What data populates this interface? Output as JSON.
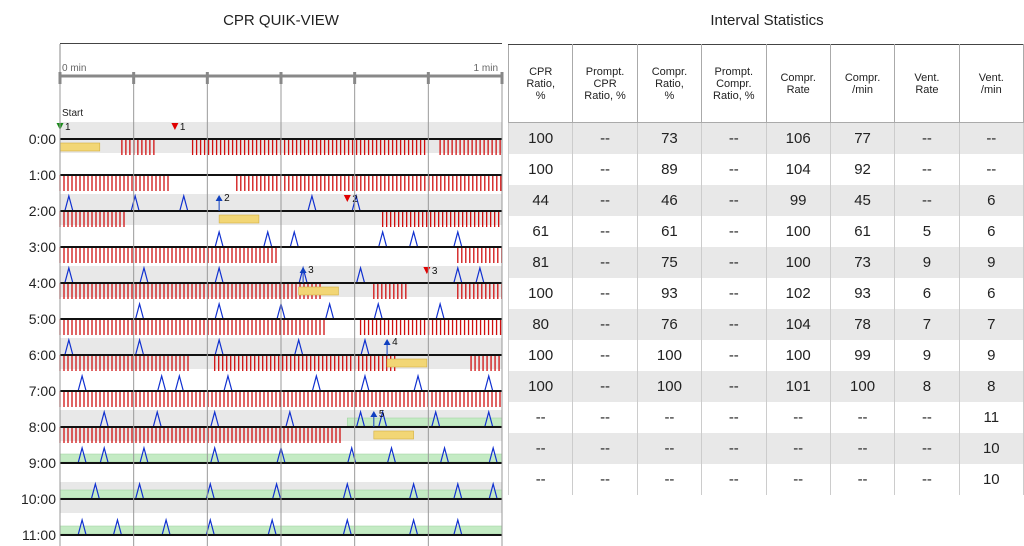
{
  "quikview": {
    "title": "CPR QUIK-VIEW",
    "axis_start": "0 min",
    "axis_end": "1 min",
    "start_label": "Start"
  },
  "stats": {
    "title": "Interval Statistics",
    "columns": [
      [
        "CPR",
        "Ratio,",
        "%"
      ],
      [
        "Prompt.",
        "CPR",
        "Ratio, %"
      ],
      [
        "Compr.",
        "Ratio,",
        "%"
      ],
      [
        "Prompt.",
        "Compr.",
        "Ratio, %"
      ],
      [
        "Compr.",
        "Rate"
      ],
      [
        "Compr.",
        "/min"
      ],
      [
        "Vent.",
        "Rate"
      ],
      [
        "Vent.",
        "/min"
      ]
    ],
    "rows": [
      [
        "100",
        "--",
        "73",
        "--",
        "106",
        "77",
        "--",
        "--"
      ],
      [
        "100",
        "--",
        "89",
        "--",
        "104",
        "92",
        "--",
        "--"
      ],
      [
        "44",
        "--",
        "46",
        "--",
        "99",
        "45",
        "--",
        "6"
      ],
      [
        "61",
        "--",
        "61",
        "--",
        "100",
        "61",
        "5",
        "6"
      ],
      [
        "81",
        "--",
        "75",
        "--",
        "100",
        "73",
        "9",
        "9"
      ],
      [
        "100",
        "--",
        "93",
        "--",
        "102",
        "93",
        "6",
        "6"
      ],
      [
        "80",
        "--",
        "76",
        "--",
        "104",
        "78",
        "7",
        "7"
      ],
      [
        "100",
        "--",
        "100",
        "--",
        "100",
        "99",
        "9",
        "9"
      ],
      [
        "100",
        "--",
        "100",
        "--",
        "101",
        "100",
        "8",
        "8"
      ],
      [
        "--",
        "--",
        "--",
        "--",
        "--",
        "--",
        "--",
        "11"
      ],
      [
        "--",
        "--",
        "--",
        "--",
        "--",
        "--",
        "--",
        "10"
      ],
      [
        "--",
        "--",
        "--",
        "--",
        "--",
        "--",
        "--",
        "10"
      ]
    ]
  },
  "timeline": {
    "minutes": [
      "0:00",
      "1:00",
      "2:00",
      "3:00",
      "4:00",
      "5:00",
      "6:00",
      "7:00",
      "8:00",
      "9:00",
      "10:00",
      "11:00"
    ],
    "compression_segments": [
      [
        [
          0.14,
          0.22
        ],
        [
          0.3,
          0.83
        ],
        [
          0.86,
          1.0
        ]
      ],
      [
        [
          0.0,
          0.25
        ],
        [
          0.4,
          1.0
        ]
      ],
      [
        [
          0.0,
          0.15
        ],
        [
          0.73,
          1.0
        ]
      ],
      [
        [
          0.0,
          0.49
        ],
        [
          0.9,
          1.0
        ]
      ],
      [
        [
          0.0,
          0.59
        ],
        [
          0.71,
          0.79
        ],
        [
          0.9,
          1.0
        ]
      ],
      [
        [
          0.0,
          0.6
        ],
        [
          0.68,
          1.0
        ]
      ],
      [
        [
          0.0,
          0.29
        ],
        [
          0.35,
          0.76
        ],
        [
          0.93,
          1.0
        ]
      ],
      [
        [
          0.0,
          1.0
        ]
      ],
      [
        [
          0.0,
          0.64
        ]
      ],
      [],
      [],
      []
    ],
    "ventilations": [
      [],
      [],
      [
        0.02,
        0.17,
        0.28,
        0.57,
        0.67
      ],
      [
        0.36,
        0.47,
        0.53,
        0.73,
        0.8,
        0.9
      ],
      [
        0.02,
        0.19,
        0.36,
        0.55,
        0.68,
        0.9,
        0.95
      ],
      [
        0.18,
        0.36,
        0.5,
        0.61,
        0.72,
        0.86
      ],
      [
        0.02,
        0.18,
        0.36,
        0.54,
        0.69
      ],
      [
        0.05,
        0.23,
        0.27,
        0.38,
        0.58,
        0.69,
        0.81,
        0.97
      ],
      [
        0.1,
        0.22,
        0.35,
        0.52,
        0.68,
        0.73,
        0.85,
        0.97
      ],
      [
        0.05,
        0.1,
        0.19,
        0.35,
        0.5,
        0.66,
        0.75,
        0.87,
        0.98
      ],
      [
        0.08,
        0.18,
        0.34,
        0.49,
        0.65,
        0.8,
        0.9,
        0.98
      ],
      [
        0.05,
        0.13,
        0.24,
        0.34,
        0.48,
        0.65,
        0.8,
        0.9
      ]
    ],
    "pauses": [
      [
        [
          0.0,
          0.09
        ]
      ],
      [],
      [
        [
          0.36,
          0.45
        ]
      ],
      [],
      [
        [
          0.54,
          0.63
        ]
      ],
      [],
      [
        [
          0.74,
          0.83
        ]
      ],
      [],
      [
        [
          0.71,
          0.8
        ]
      ],
      [],
      [],
      []
    ],
    "green_bars": [
      [],
      [],
      [],
      [],
      [],
      [],
      [],
      [],
      [
        [
          0.65,
          1.0
        ]
      ],
      [
        [
          0.0,
          1.0
        ]
      ],
      [
        [
          0.0,
          1.0
        ]
      ],
      [
        [
          0.0,
          1.0
        ]
      ]
    ],
    "markers": [
      {
        "row": 0,
        "pos": 0.0,
        "color": "#1a8a1a",
        "label": "1",
        "kind": "start"
      },
      {
        "row": 0,
        "pos": 0.26,
        "color": "#e00000",
        "label": "1",
        "kind": "down"
      },
      {
        "row": 2,
        "pos": 0.36,
        "color": "#1040c0",
        "label": "2",
        "kind": "up"
      },
      {
        "row": 2,
        "pos": 0.65,
        "color": "#e00000",
        "label": "2",
        "kind": "down"
      },
      {
        "row": 4,
        "pos": 0.55,
        "color": "#1040c0",
        "label": "3",
        "kind": "up"
      },
      {
        "row": 4,
        "pos": 0.83,
        "color": "#e00000",
        "label": "3",
        "kind": "down"
      },
      {
        "row": 6,
        "pos": 0.74,
        "color": "#1040c0",
        "label": "4",
        "kind": "up"
      },
      {
        "row": 8,
        "pos": 0.71,
        "color": "#1040c0",
        "label": "5",
        "kind": "up"
      }
    ],
    "colors": {
      "compression": "#d01010",
      "ventilation": "#1030d0",
      "pause": "#f2d675",
      "green": "#c4ebc4",
      "row_shade": "#e8e8e8"
    }
  }
}
